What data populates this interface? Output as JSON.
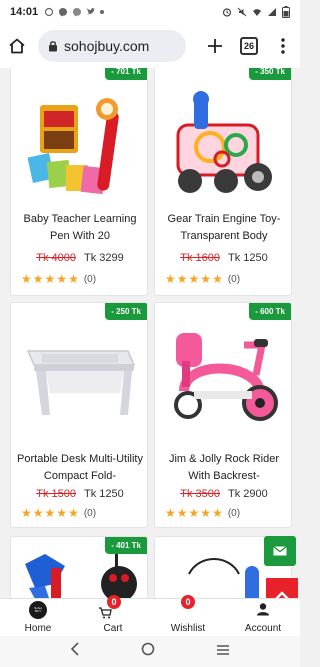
{
  "status": {
    "time": "14:01",
    "battery_icon": "battery-icon"
  },
  "browser": {
    "url": "sohojbuy.com",
    "tab_count": "26"
  },
  "products": [
    {
      "discount": "- 701 Tk",
      "title": "Baby Teacher Learning Pen With 20",
      "old_price": "Tk 4000",
      "price": "Tk 3299",
      "rating_count": "(0)"
    },
    {
      "discount": "- 350 Tk",
      "title": "Gear Train Engine Toy-Transparent Body",
      "old_price": "Tk 1600",
      "price": "Tk 1250",
      "rating_count": "(0)"
    },
    {
      "discount": "- 250 Tk",
      "title": "Portable Desk Multi-Utility Compact Fold-",
      "old_price": "Tk 1500",
      "price": "Tk 1250",
      "rating_count": "(0)"
    },
    {
      "discount": "- 600 Tk",
      "title": "Jim & Jolly Rock Rider With Backrest-",
      "old_price": "Tk 3500",
      "price": "Tk 2900",
      "rating_count": "(0)"
    },
    {
      "discount": "- 401 Tk"
    },
    {
      "discount": "- ."
    }
  ],
  "nav": {
    "home": "Home",
    "cart": "Cart",
    "cart_count": "0",
    "wishlist": "Wishlist",
    "wishlist_count": "0",
    "account": "Account",
    "home_logo_text": "Sohoj BUY"
  },
  "colors": {
    "accent": "#1a9a3c",
    "sale_red": "#d0262a",
    "star": "#f5a623"
  }
}
